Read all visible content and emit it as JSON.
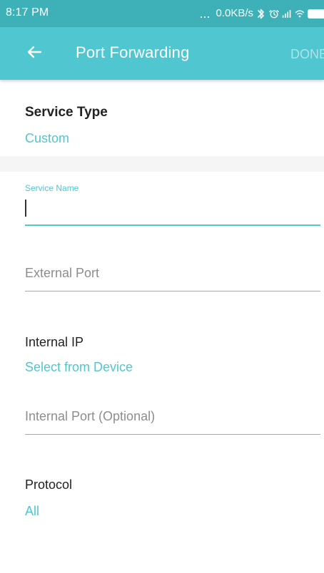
{
  "status_bar": {
    "time": "8:17 PM",
    "more_indicator": "...",
    "network_speed": "0.0KB/s",
    "icons": [
      "bluetooth-icon",
      "alarm-icon",
      "signal-icon",
      "wifi-icon",
      "battery-icon"
    ]
  },
  "header": {
    "title": "Port Forwarding",
    "done_label": "DONE",
    "back_icon": "back-arrow-icon",
    "background_color": "#4fc6d0",
    "status_bar_color": "#3db0b8",
    "done_color": "#aee4e8"
  },
  "form": {
    "service_type": {
      "label": "Service Type",
      "value": "Custom"
    },
    "service_name": {
      "label": "Service Name",
      "value": ""
    },
    "external_port": {
      "placeholder": "External Port",
      "value": ""
    },
    "internal_ip": {
      "label": "Internal IP",
      "action": "Select from Device"
    },
    "internal_port": {
      "placeholder": "Internal Port (Optional)",
      "value": ""
    },
    "protocol": {
      "label": "Protocol",
      "value": "All"
    }
  },
  "colors": {
    "accent": "#4fc6d0",
    "label_text": "#222222",
    "placeholder_text": "#8d8d8d",
    "divider": "#a8a8a8",
    "section_separator": "#f5f5f5"
  }
}
